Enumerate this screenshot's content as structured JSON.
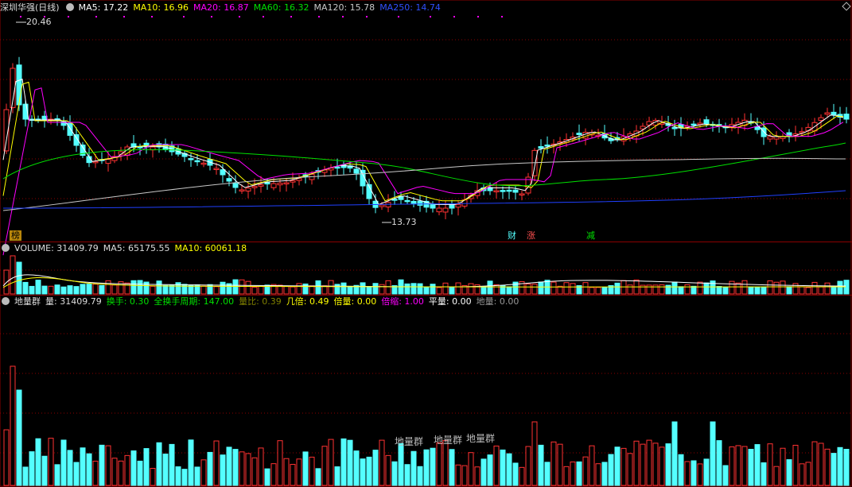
{
  "main_header": {
    "title": "深圳华强(日线)",
    "ma5": "MA5: 17.22",
    "ma10": "MA10: 16.96",
    "ma20": "MA20: 16.87",
    "ma60": "MA60: 16.32",
    "ma120": "MA120: 15.78",
    "ma250": "MA250: 14.74"
  },
  "volume_header": {
    "title": "VOLUME: 31409.79",
    "ma5": "MA5: 65175.55",
    "ma10": "MA10: 60061.18"
  },
  "indicator_header": {
    "title": "地量群",
    "liang": "量: 31409.79",
    "huanshou": "换手: 0.30",
    "zhouqi": "全换手周期: 147.00",
    "liangbi": "量比: 0.39",
    "jibei": "几倍: 0.49",
    "beiliang": "倍量: 0.00",
    "beisuo": "倍缩: 1.00",
    "pingliang": "平量: 0.00",
    "diliang": "地量: 0.00"
  },
  "annotations": {
    "high_label": "20.46",
    "low_label": "13.73",
    "watermarks": [
      "地量群",
      "地量群",
      "地量群"
    ],
    "bottom_markers": [
      "榜",
      "财",
      "涨",
      "减"
    ]
  },
  "colors": {
    "up": "#ff3232",
    "down": "#54ffff",
    "ma5": "#ffffff",
    "ma10": "#ffff00",
    "ma20": "#ff00ff",
    "ma60": "#00e000",
    "ma120": "#c8c8c8",
    "ma250": "#2040ff",
    "grid": "#8b0000"
  }
}
